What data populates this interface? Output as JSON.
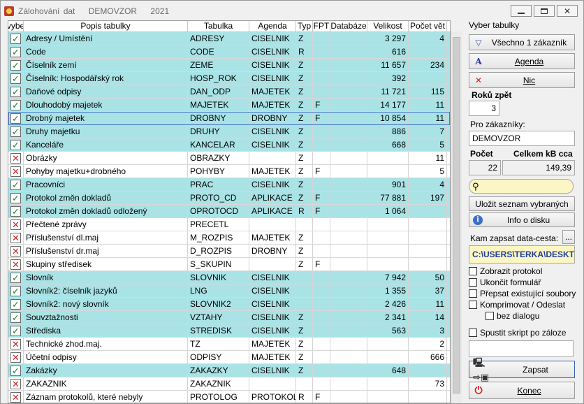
{
  "window": {
    "title_app": "Zálohování dat",
    "title_company": "DEMOVZOR",
    "title_year": "2021"
  },
  "grid": {
    "headers": [
      "vybe",
      "Popis tabulky",
      "Tabulka",
      "Agenda",
      "Typ",
      "FPT",
      "Databáze",
      "Velikost",
      "Počet vět"
    ],
    "rows": [
      {
        "sel": true,
        "popis": "Adresy / Umístění",
        "tabulka": "ADRESY",
        "agenda": "CISELNIK",
        "typ": "Z",
        "fpt": "",
        "db": "",
        "velikost": "3 297",
        "pocet": "4"
      },
      {
        "sel": true,
        "popis": "Code",
        "tabulka": "CODE",
        "agenda": "CISELNIK",
        "typ": "R",
        "fpt": "",
        "db": "",
        "velikost": "616",
        "pocet": ""
      },
      {
        "sel": true,
        "popis": "Číselník  zemí",
        "tabulka": "ZEME",
        "agenda": "CISELNIK",
        "typ": "Z",
        "fpt": "",
        "db": "",
        "velikost": "11 657",
        "pocet": "234"
      },
      {
        "sel": true,
        "popis": "Číselník: Hospodářský rok",
        "tabulka": "HOSP_ROK",
        "agenda": "CISELNIK",
        "typ": "Z",
        "fpt": "",
        "db": "",
        "velikost": "392",
        "pocet": ""
      },
      {
        "sel": true,
        "popis": "Daňové odpisy",
        "tabulka": "DAN_ODP",
        "agenda": "MAJETEK",
        "typ": "Z",
        "fpt": "",
        "db": "",
        "velikost": "11 721",
        "pocet": "115"
      },
      {
        "sel": true,
        "popis": "Dlouhodobý majetek",
        "tabulka": "MAJETEK",
        "agenda": "MAJETEK",
        "typ": "Z",
        "fpt": "F",
        "db": "",
        "velikost": "14 177",
        "pocet": "11"
      },
      {
        "sel": true,
        "popis": "Drobný majetek",
        "tabulka": "DROBNY",
        "agenda": "DROBNY",
        "typ": "Z",
        "fpt": "F",
        "db": "",
        "velikost": "10 854",
        "pocet": "11",
        "current": true
      },
      {
        "sel": true,
        "popis": "Druhy majetku",
        "tabulka": "DRUHY",
        "agenda": "CISELNIK",
        "typ": "Z",
        "fpt": "",
        "db": "",
        "velikost": "886",
        "pocet": "7"
      },
      {
        "sel": true,
        "popis": "Kanceláře",
        "tabulka": "KANCELAR",
        "agenda": "CISELNIK",
        "typ": "Z",
        "fpt": "",
        "db": "",
        "velikost": "668",
        "pocet": "5"
      },
      {
        "sel": false,
        "popis": "Obrázky",
        "tabulka": "OBRAZKY",
        "agenda": "",
        "typ": "Z",
        "fpt": "",
        "db": "",
        "velikost": "",
        "pocet": "11"
      },
      {
        "sel": false,
        "popis": "Pohyby majetku+drobného",
        "tabulka": "POHYBY",
        "agenda": "MAJETEK",
        "typ": "Z",
        "fpt": "F",
        "db": "",
        "velikost": "",
        "pocet": "5"
      },
      {
        "sel": true,
        "popis": "Pracovníci",
        "tabulka": "PRAC",
        "agenda": "CISELNIK",
        "typ": "Z",
        "fpt": "",
        "db": "",
        "velikost": "901",
        "pocet": "4"
      },
      {
        "sel": true,
        "popis": "Protokol změn dokladů",
        "tabulka": "PROTO_CD",
        "agenda": "APLIKACE",
        "typ": "Z",
        "fpt": "F",
        "db": "",
        "velikost": "77 881",
        "pocet": "197"
      },
      {
        "sel": true,
        "popis": "Protokol změn dokladů odložený",
        "tabulka": "OPROTOCD",
        "agenda": "APLIKACE",
        "typ": "R",
        "fpt": "F",
        "db": "",
        "velikost": "1 064",
        "pocet": ""
      },
      {
        "sel": false,
        "popis": "Přečtené zprávy",
        "tabulka": "PRECETL",
        "agenda": "",
        "typ": "",
        "fpt": "",
        "db": "",
        "velikost": "",
        "pocet": ""
      },
      {
        "sel": false,
        "popis": "Příslušenství dl.maj",
        "tabulka": "M_ROZPIS",
        "agenda": "MAJETEK",
        "typ": "Z",
        "fpt": "",
        "db": "",
        "velikost": "",
        "pocet": ""
      },
      {
        "sel": false,
        "popis": "Příslušenství dr.maj",
        "tabulka": "D_ROZPIS",
        "agenda": "DROBNY",
        "typ": "Z",
        "fpt": "",
        "db": "",
        "velikost": "",
        "pocet": ""
      },
      {
        "sel": false,
        "popis": "Skupiny středisek",
        "tabulka": "S_SKUPIN",
        "agenda": "",
        "typ": "Z",
        "fpt": "F",
        "db": "",
        "velikost": "",
        "pocet": ""
      },
      {
        "sel": true,
        "popis": "Slovník",
        "tabulka": "SLOVNIK",
        "agenda": "CISELNIK",
        "typ": "",
        "fpt": "",
        "db": "",
        "velikost": "7 942",
        "pocet": "50"
      },
      {
        "sel": true,
        "popis": "Slovník2: číselník jazyků",
        "tabulka": "LNG",
        "agenda": "CISELNIK",
        "typ": "",
        "fpt": "",
        "db": "",
        "velikost": "1 355",
        "pocet": "37"
      },
      {
        "sel": true,
        "popis": "Slovník2: nový slovník",
        "tabulka": "SLOVNIK2",
        "agenda": "CISELNIK",
        "typ": "",
        "fpt": "",
        "db": "",
        "velikost": "2 426",
        "pocet": "11"
      },
      {
        "sel": true,
        "popis": "Souvztažnosti",
        "tabulka": "VZTAHY",
        "agenda": "CISELNIK",
        "typ": "Z",
        "fpt": "",
        "db": "",
        "velikost": "2 341",
        "pocet": "14"
      },
      {
        "sel": true,
        "popis": "Střediska",
        "tabulka": "STREDISK",
        "agenda": "CISELNIK",
        "typ": "Z",
        "fpt": "",
        "db": "",
        "velikost": "563",
        "pocet": "3"
      },
      {
        "sel": false,
        "popis": "Technické zhod.maj.",
        "tabulka": "TZ",
        "agenda": "MAJETEK",
        "typ": "Z",
        "fpt": "",
        "db": "",
        "velikost": "",
        "pocet": "2"
      },
      {
        "sel": false,
        "popis": "Účetní odpisy",
        "tabulka": "ODPISY",
        "agenda": "MAJETEK",
        "typ": "Z",
        "fpt": "",
        "db": "",
        "velikost": "",
        "pocet": "666"
      },
      {
        "sel": true,
        "popis": "Zakázky",
        "tabulka": "ZAKAZKY",
        "agenda": "CISELNIK",
        "typ": "Z",
        "fpt": "",
        "db": "",
        "velikost": "648",
        "pocet": ""
      },
      {
        "sel": false,
        "popis": "ZAKAZNIK",
        "tabulka": "ZAKAZNIK",
        "agenda": "",
        "typ": "",
        "fpt": "",
        "db": "",
        "velikost": "",
        "pocet": "73"
      },
      {
        "sel": false,
        "popis": "Záznam protokolů, které nebyly",
        "tabulka": "PROTOLOG",
        "agenda": "PROTOKOL",
        "typ": "R",
        "fpt": "F",
        "db": "",
        "velikost": "",
        "pocet": ""
      }
    ]
  },
  "panel": {
    "select_label": "Vyber tabulky",
    "btn_all": "Všechno 1 zákazník",
    "btn_agenda": "Agenda",
    "btn_none": "Nic",
    "years_label": "Roků zpět",
    "years_value": "3",
    "customers_label": "Pro zákazníky:",
    "customers_value": "DEMOVZOR",
    "count_label": "Počet",
    "total_label": "Celkem kB cca",
    "count_value": "22",
    "total_value": "149,39",
    "btn_save_list": "Uložit seznam vybraných",
    "btn_disk_info": "Info o disku",
    "path_label": "Kam zapsat data-cesta:",
    "path_browse": "...",
    "path_value": "C:\\USERS\\TERKA\\DESKTO",
    "cb_protocol": "Zobrazit protokol",
    "cb_close_form": "Ukončit formulář",
    "cb_overwrite": "Přepsat existující soubory",
    "cb_compress": "Komprimovat / Odeslat",
    "cb_no_dialog": "bez dialogu",
    "cb_script": "Spustit skript po záloze",
    "btn_write": "Zapsat",
    "btn_end": "Konec"
  },
  "colors": {
    "selected_row": "#a9e3e6",
    "accent_blue": "#3a5fb0",
    "path_highlight": "#fbf6c4"
  }
}
